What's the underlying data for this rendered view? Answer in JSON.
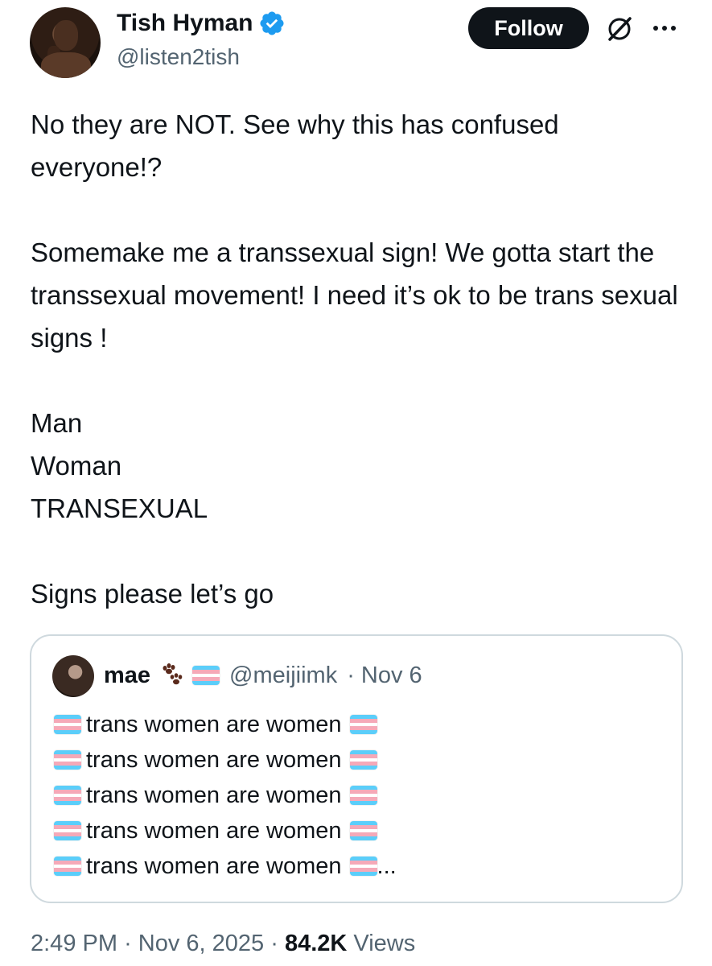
{
  "author": {
    "name": "Tish Hyman",
    "handle": "@listen2tish",
    "verified": true
  },
  "actions": {
    "follow_label": "Follow",
    "grok_icon": "grok-icon",
    "more_icon": "more-icon"
  },
  "tweet": {
    "paragraphs": [
      "No they are NOT. See why this has confused everyone!?",
      "Somemake me a transsexual sign! We gotta start the transsexual movement! I need it’s ok to be trans sexual signs !",
      "Man\nWoman\nTRANSEXUAL",
      "Signs please let’s go"
    ]
  },
  "quote": {
    "name": "mae",
    "handle": "@meijiimk",
    "date": "· Nov 6",
    "lines": [
      "trans women are women",
      "trans women are women",
      "trans women are women",
      "trans women are women",
      "trans women are women"
    ],
    "truncation": "..."
  },
  "meta": {
    "time": "2:49 PM",
    "date": "Nov 6, 2025",
    "views_count": "84.2K",
    "views_label": "Views"
  },
  "colors": {
    "text": "#0f1419",
    "secondary": "#536471",
    "verified": "#1d9bf0",
    "border": "#cfd9de",
    "trans_blue": "#5bcefa",
    "trans_pink": "#f5a9b8"
  }
}
